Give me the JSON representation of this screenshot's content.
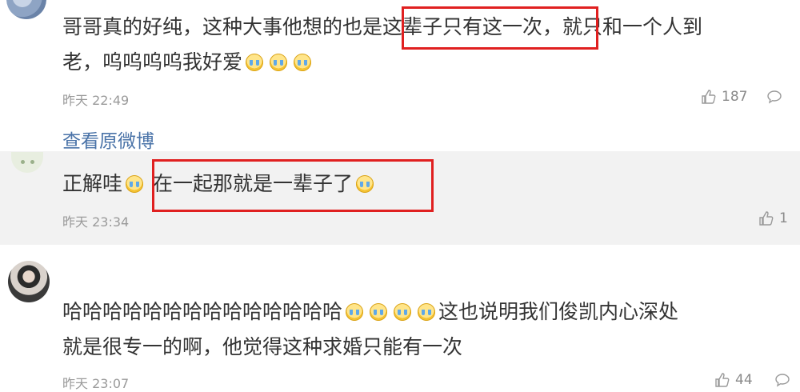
{
  "comments": [
    {
      "text_line1_a": "哥哥真的好纯，这种大事他想的也是",
      "text_line1_highlight": "这辈子只有这一次",
      "text_line1_b": "，就只和一个人到",
      "text_line2": "老，呜呜呜呜我好爱",
      "timestamp": "昨天 22:49",
      "likes": "187",
      "view_original": "查看原微博"
    },
    {
      "text_a": "正解哇",
      "text_highlight": "在一起那就是一辈子了",
      "timestamp": "昨天 23:34",
      "likes": "1"
    },
    {
      "text_line1": "哈哈哈哈哈哈哈哈哈哈哈哈哈哈",
      "text_line1_b": "这也说明我们俊凯内心深处",
      "text_line2": "就是很专一的啊，他觉得这种求婚只能有一次",
      "timestamp": "昨天 23:07",
      "likes": "44"
    }
  ],
  "icons": {
    "like": "thumbs-up-icon",
    "comment": "comment-bubble-icon",
    "emoji": "crying-face-emoji"
  },
  "colors": {
    "highlight_border": "#e02020",
    "link": "#4a73a8",
    "reply_bg": "#f2f2f2"
  }
}
